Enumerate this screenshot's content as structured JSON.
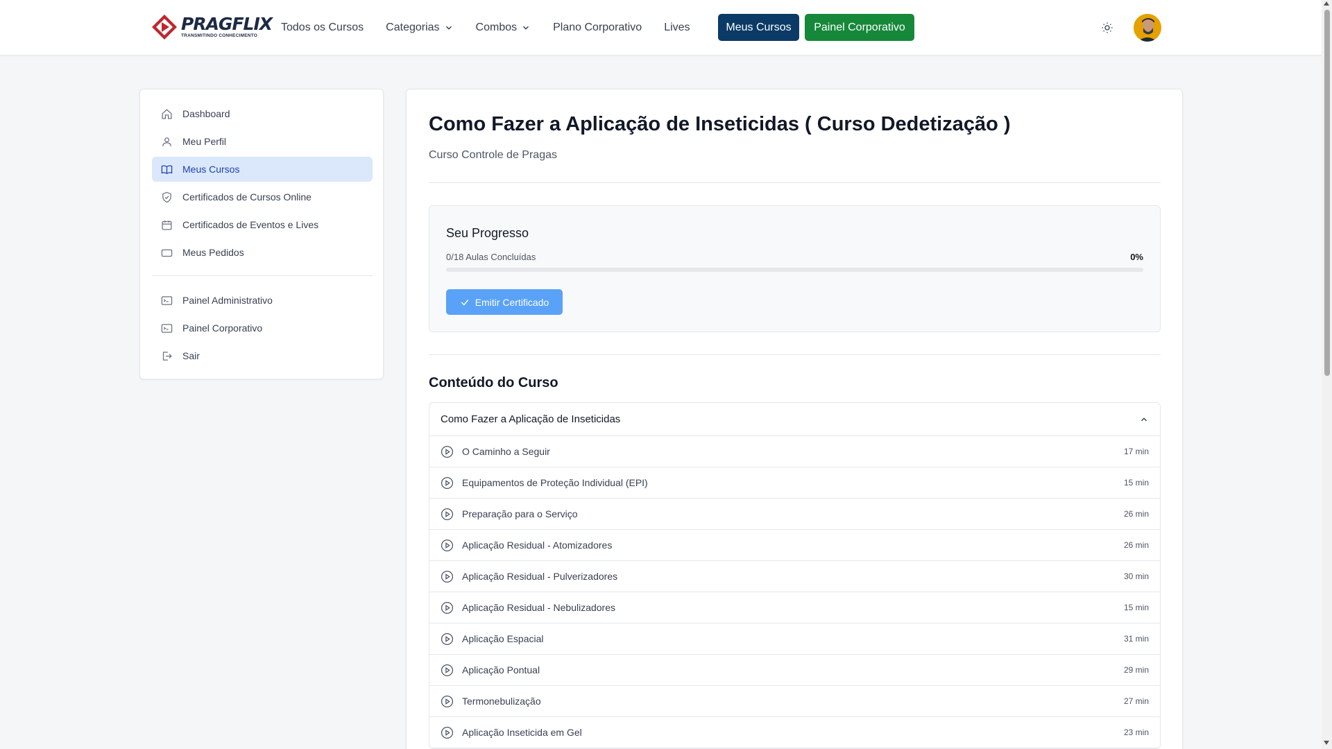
{
  "header": {
    "logo_name": "PRAGFLIX",
    "logo_tagline": "TRANSMITINDO CONHECIMENTO",
    "nav": [
      {
        "label": "Todos os Cursos",
        "dropdown": false
      },
      {
        "label": "Categorias",
        "dropdown": true
      },
      {
        "label": "Combos",
        "dropdown": true
      },
      {
        "label": "Plano Corporativo",
        "dropdown": false
      },
      {
        "label": "Lives",
        "dropdown": false
      }
    ],
    "meus_cursos_label": "Meus Cursos",
    "painel_corporativo_label": "Painel Corporativo",
    "theme_icon": "sun-icon",
    "colors": {
      "meus_cursos_bg": "#0b3a66",
      "painel_bg": "#16883a"
    }
  },
  "sidebar": {
    "items": [
      {
        "label": "Dashboard",
        "icon": "home-icon",
        "active": false
      },
      {
        "label": "Meu Perfil",
        "icon": "user-icon",
        "active": false
      },
      {
        "label": "Meus Cursos",
        "icon": "book-open-icon",
        "active": true
      },
      {
        "label": "Certificados de Cursos Online",
        "icon": "shield-check-icon",
        "active": false
      },
      {
        "label": "Certificados de Eventos e Lives",
        "icon": "calendar-icon",
        "active": false
      },
      {
        "label": "Meus Pedidos",
        "icon": "credit-card-icon",
        "active": false
      }
    ],
    "admin_items": [
      {
        "label": "Painel Administrativo",
        "icon": "terminal-icon"
      },
      {
        "label": "Painel Corporativo",
        "icon": "terminal-icon"
      },
      {
        "label": "Sair",
        "icon": "logout-icon"
      }
    ],
    "active_color": "#dbe8fb"
  },
  "course": {
    "title": "Como Fazer a Aplicação de Inseticidas ( Curso Dedetização )",
    "subtitle": "Curso Controle de Pragas"
  },
  "progress": {
    "title": "Seu Progresso",
    "count_text": "0/18 Aulas Concluídas",
    "percent_text": "0%",
    "fraction": 0,
    "certificate_button": "Emitir Certificado",
    "button_color": "#5aa2f7"
  },
  "content": {
    "title": "Conteúdo do Curso",
    "module_title": "Como Fazer a Aplicação de Inseticidas",
    "lessons": [
      {
        "title": "O Caminho a Seguir",
        "duration": "17 min"
      },
      {
        "title": "Equipamentos de Proteção Individual (EPI)",
        "duration": "15 min"
      },
      {
        "title": "Preparação para o Serviço",
        "duration": "26 min"
      },
      {
        "title": "Aplicação Residual - Atomizadores",
        "duration": "26 min"
      },
      {
        "title": "Aplicação Residual - Pulverizadores",
        "duration": "30 min"
      },
      {
        "title": "Aplicação Residual - Nebulizadores",
        "duration": "15 min"
      },
      {
        "title": "Aplicação Espacial",
        "duration": "31 min"
      },
      {
        "title": "Aplicação Pontual",
        "duration": "29 min"
      },
      {
        "title": "Termonebulização",
        "duration": "27 min"
      },
      {
        "title": "Aplicação Inseticida em Gel",
        "duration": "23 min"
      }
    ]
  }
}
